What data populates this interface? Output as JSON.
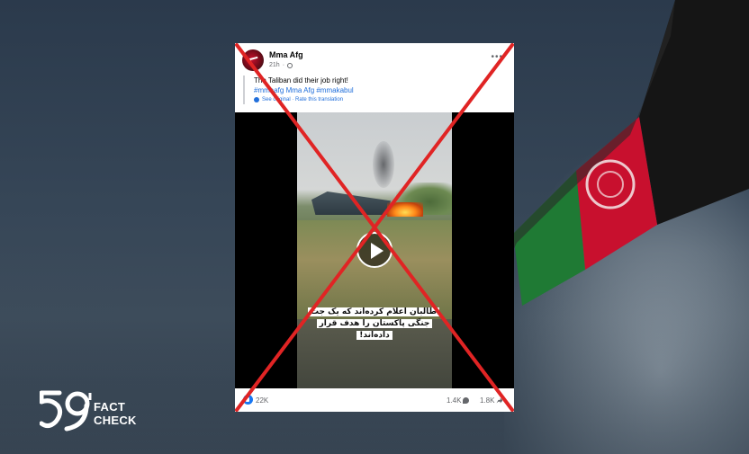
{
  "post": {
    "author": "Mma Afg",
    "time": "21h",
    "text": "The Taliban did their job right!",
    "hashtags": "#mmaafg Mma Afg #mmakabul",
    "translation_links": "See original · Rate this translation",
    "video_caption": "طالبان اعلام کرده‌اند که یک جت جنگی پاکستان را هدف قرار داده‌اند!",
    "reactions": "22K",
    "comments": "1.4K",
    "shares": "1.8K"
  },
  "logo": {
    "line1": "FACT",
    "line2": "CHECK"
  },
  "colors": {
    "cross": "#e02424",
    "link": "#216fdb",
    "flag_black": "#141414",
    "flag_red": "#c8102e",
    "flag_green": "#1f7a34"
  },
  "icons": [
    "globe-icon",
    "more-icon",
    "gear-icon",
    "play-icon",
    "like-icon",
    "comment-icon",
    "share-icon"
  ]
}
